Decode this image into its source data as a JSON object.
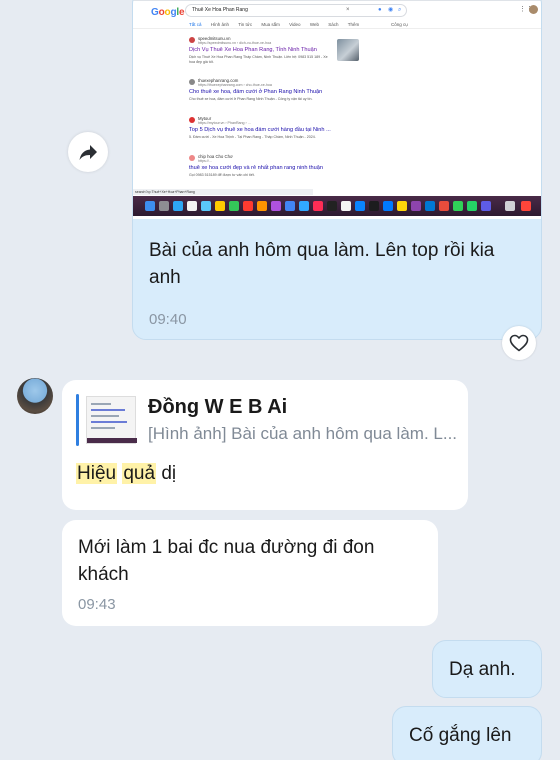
{
  "screenshot": {
    "search_query": "Thuê Xe Hoa Phan Rang",
    "nav_tabs": [
      "Tất cả",
      "Hình ảnh",
      "Tin tức",
      "Mua sắm",
      "Video",
      "Web",
      "Sách",
      "Thêm"
    ],
    "tools_label": "Công cụ",
    "results": [
      {
        "site": "speedmitsunu.vn",
        "url": "https://speedmitsunu.vn › dich-vu-thue-xe-hoa",
        "title": "Dịch Vụ Thuê Xe Hoa Phan Rang, Tỉnh Ninh Thuận",
        "snippet": "Dịch vụ Thuê Xe Hoa Phan Rang Tháp Chàm, Ninh Thuận. Liên hệ: 0983 515 189 - Xe hoa đẹp giá tốt."
      },
      {
        "site": "thuexephanrang.com",
        "url": "https://thuexephanrang.com › cho-thue-xe-hoa",
        "title": "Cho thuê xe hoa, đám cưới ở Phan Rang Ninh Thuận",
        "snippet": "Cho thuê xe hoa, đám cưới ở Phan Rang Ninh Thuận - Công ty vận tải uy tín."
      },
      {
        "site": "Mytour",
        "url": "https://mytour.vn › PhanRang › ...",
        "title": "Top 5 Dịch vụ thuê xe hoa đám cưới hàng đầu tại Ninh ...",
        "snippet": "5. Đám cưới - Xe Hoa Thịnh - Tại Phan Rang - Tháp Chàm, Ninh Thuận - 2024."
      },
      {
        "site": "chip hoa Cho Chơ",
        "url": "https://...",
        "title": "thuê xe hoa cưới đẹp và rẻ nhất phan rang ninh thuận",
        "snippet": "Gọi 0983 515189 để được tư vấn chi tiết."
      }
    ],
    "status_text": "search?q=Thuê+Xe+Hoa+Phan+Rang"
  },
  "messages": {
    "outgoing_screenshot": {
      "text": "Bài của anh hôm qua làm. Lên top rồi kia anh",
      "time": "09:40"
    },
    "reply_message": {
      "quoted_sender": "Đồng W E B Ai",
      "quoted_preview": "[Hình ảnh] Bài của anh hôm qua làm. L...",
      "text_highlight_1": "Hiệu",
      "text_highlight_2": "quả",
      "text_rest": "dị"
    },
    "incoming_2": {
      "text": "Mới làm 1 bai đc nua đường đi đon khách",
      "time": "09:43"
    },
    "outgoing_2": {
      "text": "Dạ anh."
    },
    "outgoing_3": {
      "text": "Cố gắng lên"
    }
  },
  "icons": {
    "forward": "forward-arrow-icon",
    "reaction": "heart-outline-icon",
    "avatar": "user-avatar"
  },
  "colors": {
    "background": "#e6ebf2",
    "outgoing_bubble": "#d8ecfb",
    "incoming_bubble": "#ffffff",
    "highlight": "#fff2a8",
    "reply_bar": "#2f7fe0"
  }
}
